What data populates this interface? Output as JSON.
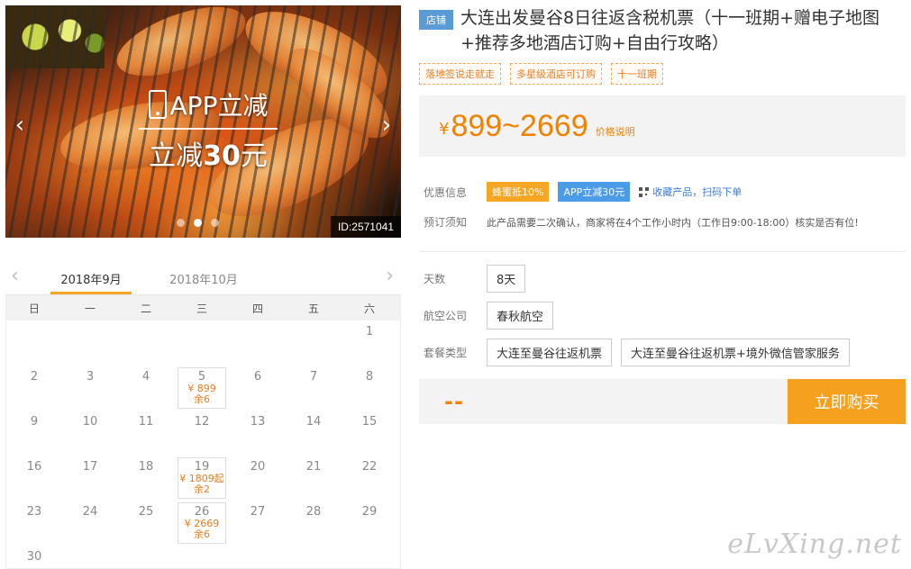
{
  "hero": {
    "promo_line1": "APP立减",
    "promo_line2_prefix": "立减",
    "promo_line2_amount": "30",
    "promo_line2_suffix": "元",
    "prev_glyph": "‹",
    "next_glyph": "›",
    "id_label": "ID:2571041"
  },
  "calendar": {
    "prev_glyph": "‹",
    "next_glyph": "›",
    "months": [
      "2018年9月",
      "2018年10月"
    ],
    "weekdays": [
      "日",
      "一",
      "二",
      "三",
      "四",
      "五",
      "六"
    ],
    "days": [
      {
        "d": "",
        "price": "",
        "left": ""
      },
      {
        "d": "",
        "price": "",
        "left": ""
      },
      {
        "d": "",
        "price": "",
        "left": ""
      },
      {
        "d": "",
        "price": "",
        "left": ""
      },
      {
        "d": "",
        "price": "",
        "left": ""
      },
      {
        "d": "",
        "price": "",
        "left": ""
      },
      {
        "d": "1",
        "price": "",
        "left": ""
      },
      {
        "d": "2",
        "price": "",
        "left": ""
      },
      {
        "d": "3",
        "price": "",
        "left": ""
      },
      {
        "d": "4",
        "price": "",
        "left": ""
      },
      {
        "d": "5",
        "price": "¥ 899",
        "left": "余6"
      },
      {
        "d": "6",
        "price": "",
        "left": ""
      },
      {
        "d": "7",
        "price": "",
        "left": ""
      },
      {
        "d": "8",
        "price": "",
        "left": ""
      },
      {
        "d": "9",
        "price": "",
        "left": ""
      },
      {
        "d": "10",
        "price": "",
        "left": ""
      },
      {
        "d": "11",
        "price": "",
        "left": ""
      },
      {
        "d": "12",
        "price": "",
        "left": ""
      },
      {
        "d": "13",
        "price": "",
        "left": ""
      },
      {
        "d": "14",
        "price": "",
        "left": ""
      },
      {
        "d": "15",
        "price": "",
        "left": ""
      },
      {
        "d": "16",
        "price": "",
        "left": ""
      },
      {
        "d": "17",
        "price": "",
        "left": ""
      },
      {
        "d": "18",
        "price": "",
        "left": ""
      },
      {
        "d": "19",
        "price": "¥ 1809起",
        "left": "余2"
      },
      {
        "d": "20",
        "price": "",
        "left": ""
      },
      {
        "d": "21",
        "price": "",
        "left": ""
      },
      {
        "d": "22",
        "price": "",
        "left": ""
      },
      {
        "d": "23",
        "price": "",
        "left": ""
      },
      {
        "d": "24",
        "price": "",
        "left": ""
      },
      {
        "d": "25",
        "price": "",
        "left": ""
      },
      {
        "d": "26",
        "price": "¥ 2669",
        "left": "余6"
      },
      {
        "d": "27",
        "price": "",
        "left": ""
      },
      {
        "d": "28",
        "price": "",
        "left": ""
      },
      {
        "d": "29",
        "price": "",
        "left": ""
      },
      {
        "d": "30",
        "price": "",
        "left": ""
      }
    ]
  },
  "product": {
    "shop_tag": "店铺",
    "title": "大连出发曼谷8日往返含税机票（十一班期+赠电子地图+推荐多地酒店订购+自由行攻略）",
    "tags": [
      "落地签说走就走",
      "多星级酒店可订购",
      "十一班期"
    ],
    "price_symbol": "¥",
    "price_range": "899~2669",
    "price_note": "价格说明",
    "discount_label": "优惠信息",
    "badge_1": "蜂蜜抵10%",
    "badge_2": "APP立减30元",
    "qr_text": "收藏产品，扫码下单",
    "notice_label": "预订须知",
    "notice_text": "此产品需要二次确认，商家将在4个工作小时内（工作日9:00-18:00）核实是否有位!",
    "days_label": "天数",
    "days_value": "8天",
    "airline_label": "航空公司",
    "airline_value": "春秋航空",
    "package_label": "套餐类型",
    "package_options": [
      "大连至曼谷往返机票",
      "大连至曼谷往返机票+境外微信管家服务"
    ],
    "total_dash": "--",
    "buy_label": "立即购买"
  },
  "watermark": "eLvXing.net",
  "colors": {
    "accent": "#f08200",
    "buy_button": "#f5a01e",
    "shop_tag": "#5b9bd5",
    "link": "#3a7bd5"
  },
  "icons": [
    "phone-icon",
    "chevron-left-icon",
    "chevron-right-icon",
    "qr-code-icon"
  ]
}
